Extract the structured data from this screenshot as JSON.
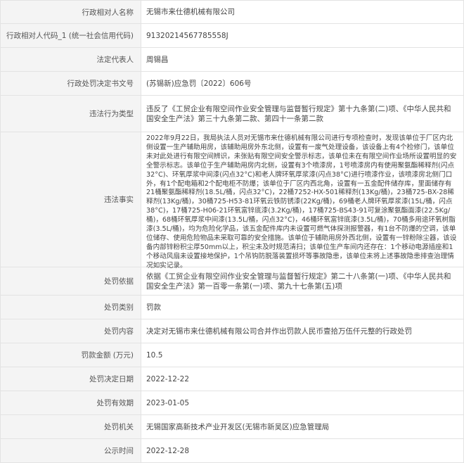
{
  "rows": [
    {
      "label": "行政相对人名称",
      "value": "无锡市来仕德机械有限公司"
    },
    {
      "label": "行政相对人代码_1 (统一社会信用代码)",
      "value": "91320214567785558J"
    },
    {
      "label": "法定代表人",
      "value": "周锡昌"
    },
    {
      "label": "行政处罚决定书文号",
      "value": "(苏锡新)应急罚〔2022〕606号"
    },
    {
      "label": "违法行为类型",
      "value": "违反了《工贸企业有限空间作业安全管理与监督暂行规定》第十九条第(二)项、《中华人民共和国安全生产法》第三十九条第二款、第四十一条第二款"
    },
    {
      "label": "违法事实",
      "value": "2022年9月22日，我局执法人员对无锡市来仕德机械有限公司进行专项检查时，发现该单位于厂区内北侧设置一生产辅助用房，该辅助用房外东北侧，设置有一废气处理设备，该设备上有4个检修门，该单位未对此处进行有限空间辨识，未张贴有限空间安全警示标志，该单位未在有限空间作业场所设置明显的安全警示标志。该单位于生产辅助用房内北侧，设置有3个喷漆房，1号喷漆房内有使用聚氨酯稀释剂(闪点32°C)、环氧厚浆中间漆(闪点32°C)和老人牌环氧厚浆漆(闪点38°C)进行喷漆作业，该喷漆房北侧门口外，有1个配电箱和2个配电柜不防爆；该单位于厂区内西北角，设置有一五金配件储存库，里面储存有21桶聚氨酯稀释剂(18.5L/桶，闪点32°C)，22桶7252-HX-501稀释剂(13Kg/桶)，23桶725-BX-28稀释剂(13Kg/桶)，30桶725-H53-81环氧云铁防锈漆(22Kg/桶)，69桶老人牌环氧厚浆漆(15L/桶，闪点38°C)，17桶725-H06-21环氧富锌底漆(3.2Kg/桶)，17桶725-BS43-91可复涂聚氨酯面漆(22.5Kg/桶)，68桶环氧厚浆中间漆(13.5L/桶，闪点32°C)，46桶环氧富锌底漆(3.5L/桶)，70桶多用途环氧树脂漆(3.5L/桶)，均为危险化学品，该五金配件库内未设置可燃气体探测报警器，有1台不防爆的空调，该单位储存、使用危险物品未采取可靠的安全措施。该单位于辅助用房外西北侧，设置有一锌粉除尘器，该设备内部锌粉积尘厚50mm以上，积尘未及时规范清扫；该单位生产车间内还存在：1个移动电源插座和1个移动风扇未设置接地保护，1个吊钩防脱落装置损坏等事故隐患，该单位未将上述事故隐患排查治理情况如实记录。"
    },
    {
      "label": "处罚依据",
      "value": "依据《工贸企业有限空间作业安全管理与监督暂行规定》第二十八条第(一)项、《中华人民共和国安全生产法》第一百零一条第(一)项、第九十七条第(五)项"
    },
    {
      "label": "处罚类别",
      "value": "罚款"
    },
    {
      "label": "处罚内容",
      "value": "决定对无锡市来仕德机械有限公司合并作出罚款人民币壹拾万伍仟元整的行政处罚"
    },
    {
      "label": "罚款金额 (万元)",
      "value": "10.5"
    },
    {
      "label": "处罚决定日期",
      "value": "2022-12-22"
    },
    {
      "label": "处罚有效期",
      "value": "2023-01-05"
    },
    {
      "label": "处罚机关",
      "value": "无锡国家高新技术产业开发区(无锡市新吴区)应急管理局"
    },
    {
      "label": "公示时间",
      "value": "2022-12-28"
    }
  ]
}
